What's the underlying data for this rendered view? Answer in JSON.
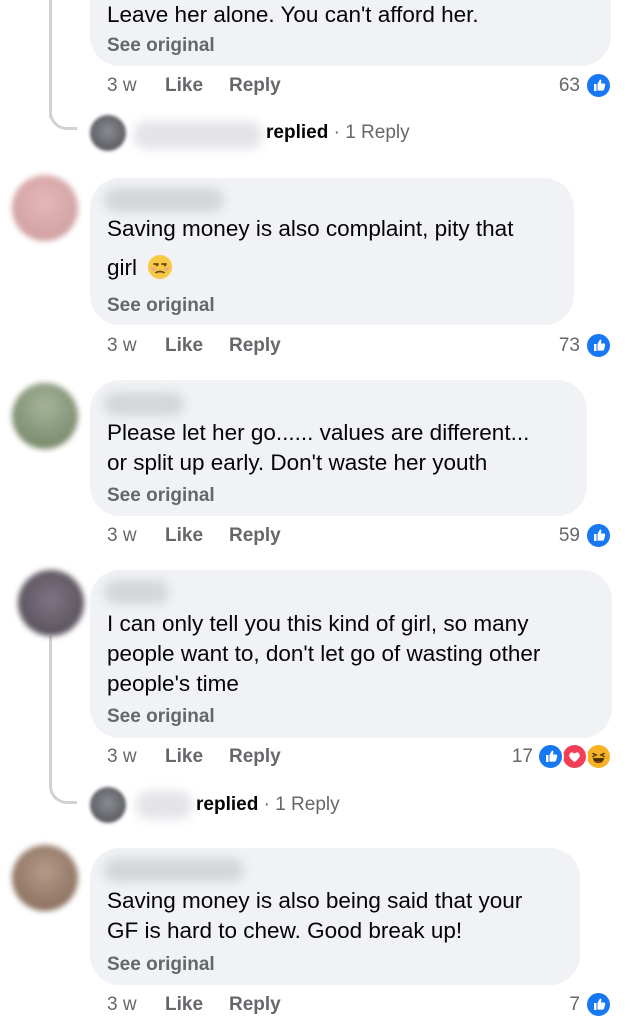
{
  "comments": [
    {
      "text_lines": [
        "Leave her alone. You can't afford her."
      ],
      "see_original": "See original",
      "time": "3 w",
      "like": "Like",
      "reply": "Reply",
      "reaction_count": "63",
      "reactions": [
        "like-icon"
      ]
    },
    {
      "text_lines": [
        "Saving money is also complaint, pity that",
        "girl"
      ],
      "emoji": "unamused-face-emoji",
      "see_original": "See original",
      "time": "3 w",
      "like": "Like",
      "reply": "Reply",
      "reaction_count": "73",
      "reactions": [
        "like-icon"
      ]
    },
    {
      "text_lines": [
        "Please let her go...... values are different...",
        "or split up early. Don't waste her youth"
      ],
      "see_original": "See original",
      "time": "3 w",
      "like": "Like",
      "reply": "Reply",
      "reaction_count": "59",
      "reactions": [
        "like-icon"
      ]
    },
    {
      "text_lines": [
        "I can only tell you this kind of girl, so many",
        "people want to, don't let go of wasting other",
        "people's time"
      ],
      "see_original": "See original",
      "time": "3 w",
      "like": "Like",
      "reply": "Reply",
      "reaction_count": "17",
      "reactions": [
        "like-icon",
        "love-icon",
        "haha-icon"
      ]
    },
    {
      "text_lines": [
        "Saving money is also being said that your",
        "GF is hard to chew. Good break up!"
      ],
      "see_original": "See original",
      "time": "3 w",
      "like": "Like",
      "reply": "Reply",
      "reaction_count": "7",
      "reactions": [
        "like-icon"
      ]
    }
  ],
  "reply_threads": [
    {
      "replied": "replied",
      "sep": " · ",
      "count": "1 Reply"
    },
    {
      "replied": "replied",
      "sep": " · ",
      "count": "1 Reply"
    }
  ],
  "colors": {
    "bubble": "#f0f2f5",
    "meta_text": "#65676b",
    "like_blue": "#1877f2",
    "love_red": "#f33e58",
    "haha_yellow": "#f7b125"
  }
}
